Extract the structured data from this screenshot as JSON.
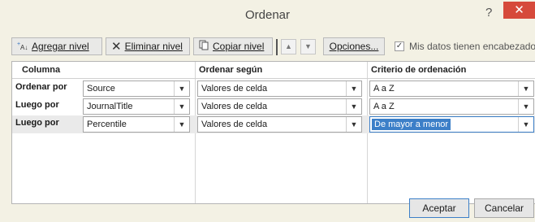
{
  "window": {
    "title": "Ordenar",
    "help": "?",
    "close": "✕"
  },
  "toolbar": {
    "add_level": "Agregar nivel",
    "delete_level": "Eliminar nivel",
    "copy_level": "Copiar nivel",
    "move_up": "▲",
    "move_down": "▼",
    "options": "Opciones...",
    "has_headers_label": "Mis datos tienen encabezados",
    "has_headers_checked": true
  },
  "grid": {
    "headers": {
      "column": "Columna",
      "sort_on": "Ordenar según",
      "order": "Criterio de ordenación"
    },
    "rows": [
      {
        "label": "Ordenar por",
        "column": "Source",
        "sort_on": "Valores de celda",
        "order": "A a Z"
      },
      {
        "label": "Luego por",
        "column": "JournalTitle",
        "sort_on": "Valores de celda",
        "order": "A a Z"
      },
      {
        "label": "Luego por",
        "column": "Percentile",
        "sort_on": "Valores de celda",
        "order": "De mayor a menor"
      }
    ],
    "selected_row": 2
  },
  "footer": {
    "accept": "Aceptar",
    "cancel": "Cancelar"
  },
  "colors": {
    "close": "#d64a3b",
    "selection": "#3c7fc8",
    "dialog_bg": "#f3f1e4"
  }
}
